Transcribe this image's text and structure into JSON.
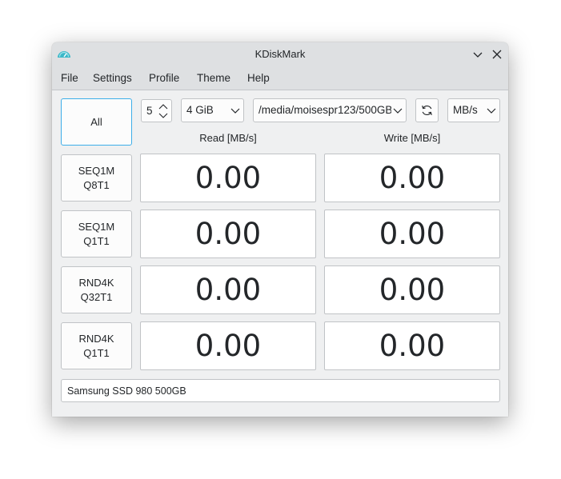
{
  "window": {
    "title": "KDiskMark",
    "icons": {
      "app": "speedometer-icon",
      "minimize": "chevron-down-icon",
      "close": "close-icon"
    }
  },
  "menu": [
    "File",
    "Settings",
    "Profile",
    "Theme",
    "Help"
  ],
  "toolbar": {
    "all_label": "All",
    "loops_value": "5",
    "size_value": "4 GiB",
    "path_value": "/media/moisespr123/500GB",
    "unit_value": "MB/s",
    "refresh_icon": "refresh-icon"
  },
  "columns": {
    "read": "Read [MB/s]",
    "write": "Write [MB/s]"
  },
  "tests": [
    {
      "line1": "SEQ1M",
      "line2": "Q8T1",
      "read": "0.00",
      "write": "0.00"
    },
    {
      "line1": "SEQ1M",
      "line2": "Q1T1",
      "read": "0.00",
      "write": "0.00"
    },
    {
      "line1": "RND4K",
      "line2": "Q32T1",
      "read": "0.00",
      "write": "0.00"
    },
    {
      "line1": "RND4K",
      "line2": "Q1T1",
      "read": "0.00",
      "write": "0.00"
    }
  ],
  "device": "Samsung SSD 980 500GB",
  "colors": {
    "accent": "#3daee9",
    "window_bg": "#eff0f1",
    "titlebar_bg": "#dee0e2",
    "icon": "#3cb8c8"
  }
}
